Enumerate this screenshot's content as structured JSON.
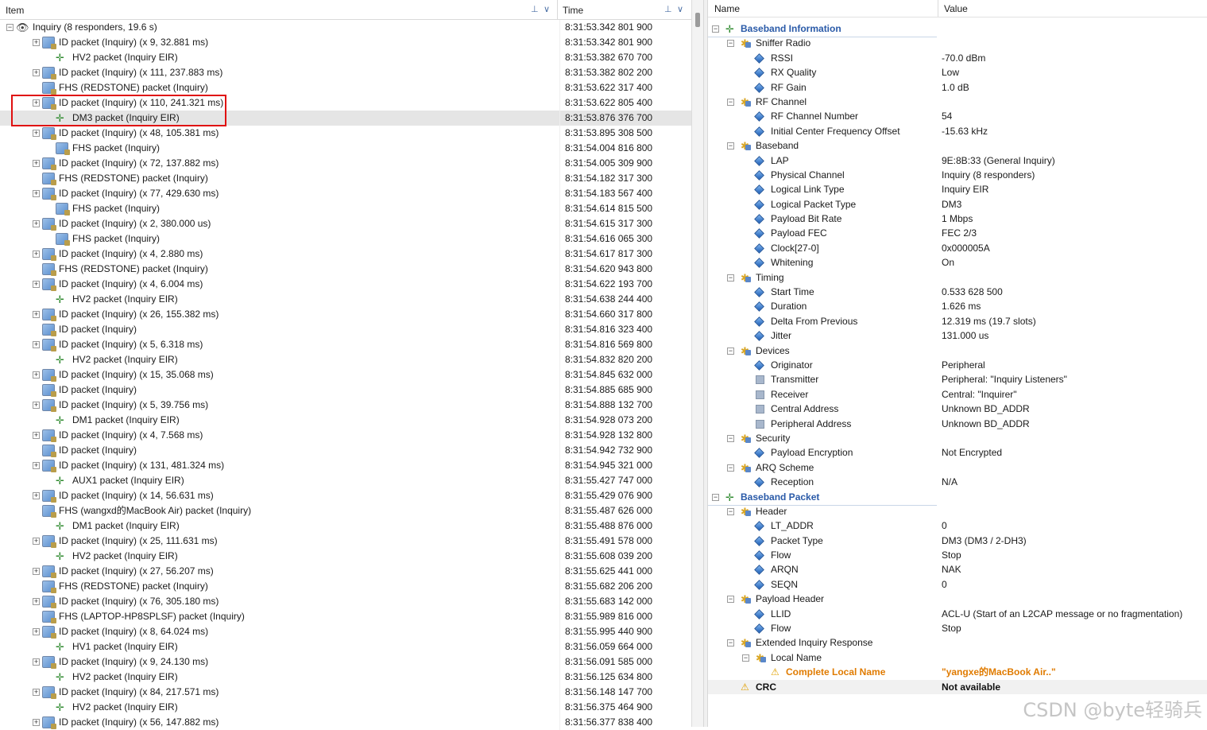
{
  "left": {
    "headers": {
      "item": "Item",
      "time": "Time"
    },
    "rows": [
      {
        "indent": 0,
        "toggle": "−",
        "icon": "eye-icon",
        "label": "Inquiry (8 responders, 19.6 s)",
        "time": "8:31:53.342 801 900"
      },
      {
        "indent": 1,
        "toggle": "+",
        "icon": "multi-packet-icon",
        "label": "ID packet (Inquiry) (x 9, 32.881 ms)",
        "time": "8:31:53.342 801 900"
      },
      {
        "indent": 2,
        "toggle": "",
        "icon": "packet-icon",
        "label": "HV2 packet (Inquiry EIR)",
        "time": "8:31:53.382 670 700"
      },
      {
        "indent": 1,
        "toggle": "+",
        "icon": "multi-packet-icon",
        "label": "ID packet (Inquiry) (x 111, 237.883 ms)",
        "time": "8:31:53.382 802 200"
      },
      {
        "indent": 1,
        "toggle": "",
        "icon": "fhs-icon",
        "label": "FHS (REDSTONE) packet (Inquiry)",
        "time": "8:31:53.622 317 400"
      },
      {
        "indent": 1,
        "toggle": "+",
        "icon": "multi-packet-icon",
        "label": "ID packet (Inquiry) (x 110, 241.321 ms)",
        "time": "8:31:53.622 805 400"
      },
      {
        "indent": 2,
        "toggle": "",
        "icon": "packet-icon",
        "label": "DM3 packet (Inquiry EIR)",
        "time": "8:31:53.876 376 700",
        "selected": true
      },
      {
        "indent": 1,
        "toggle": "+",
        "icon": "multi-packet-icon",
        "label": "ID packet (Inquiry) (x 48, 105.381 ms)",
        "time": "8:31:53.895 308 500"
      },
      {
        "indent": 2,
        "toggle": "",
        "icon": "fhs-icon",
        "label": "FHS packet (Inquiry)",
        "time": "8:31:54.004 816 800"
      },
      {
        "indent": 1,
        "toggle": "+",
        "icon": "multi-packet-icon",
        "label": "ID packet (Inquiry) (x 72, 137.882 ms)",
        "time": "8:31:54.005 309 900"
      },
      {
        "indent": 1,
        "toggle": "",
        "icon": "fhs-icon",
        "label": "FHS (REDSTONE) packet (Inquiry)",
        "time": "8:31:54.182 317 300"
      },
      {
        "indent": 1,
        "toggle": "+",
        "icon": "multi-packet-icon",
        "label": "ID packet (Inquiry) (x 77, 429.630 ms)",
        "time": "8:31:54.183 567 400"
      },
      {
        "indent": 2,
        "toggle": "",
        "icon": "fhs-icon",
        "label": "FHS packet (Inquiry)",
        "time": "8:31:54.614 815 500"
      },
      {
        "indent": 1,
        "toggle": "+",
        "icon": "multi-packet-icon",
        "label": "ID packet (Inquiry) (x 2, 380.000 us)",
        "time": "8:31:54.615 317 300"
      },
      {
        "indent": 2,
        "toggle": "",
        "icon": "fhs-icon",
        "label": "FHS packet (Inquiry)",
        "time": "8:31:54.616 065 300"
      },
      {
        "indent": 1,
        "toggle": "+",
        "icon": "multi-packet-icon",
        "label": "ID packet (Inquiry) (x 4, 2.880 ms)",
        "time": "8:31:54.617 817 300"
      },
      {
        "indent": 1,
        "toggle": "",
        "icon": "fhs-icon",
        "label": "FHS (REDSTONE) packet (Inquiry)",
        "time": "8:31:54.620 943 800"
      },
      {
        "indent": 1,
        "toggle": "+",
        "icon": "multi-packet-icon",
        "label": "ID packet (Inquiry) (x 4, 6.004 ms)",
        "time": "8:31:54.622 193 700"
      },
      {
        "indent": 2,
        "toggle": "",
        "icon": "packet-icon",
        "label": "HV2 packet (Inquiry EIR)",
        "time": "8:31:54.638 244 400"
      },
      {
        "indent": 1,
        "toggle": "+",
        "icon": "multi-packet-icon",
        "label": "ID packet (Inquiry) (x 26, 155.382 ms)",
        "time": "8:31:54.660 317 800"
      },
      {
        "indent": 1,
        "toggle": "",
        "icon": "multi-packet-icon",
        "label": "ID packet (Inquiry)",
        "time": "8:31:54.816 323 400"
      },
      {
        "indent": 1,
        "toggle": "+",
        "icon": "multi-packet-icon",
        "label": "ID packet (Inquiry) (x 5, 6.318 ms)",
        "time": "8:31:54.816 569 800"
      },
      {
        "indent": 2,
        "toggle": "",
        "icon": "packet-icon",
        "label": "HV2 packet (Inquiry EIR)",
        "time": "8:31:54.832 820 200"
      },
      {
        "indent": 1,
        "toggle": "+",
        "icon": "multi-packet-icon",
        "label": "ID packet (Inquiry) (x 15, 35.068 ms)",
        "time": "8:31:54.845 632 000"
      },
      {
        "indent": 1,
        "toggle": "",
        "icon": "multi-packet-icon",
        "label": "ID packet (Inquiry)",
        "time": "8:31:54.885 685 900"
      },
      {
        "indent": 1,
        "toggle": "+",
        "icon": "multi-packet-icon",
        "label": "ID packet (Inquiry) (x 5, 39.756 ms)",
        "time": "8:31:54.888 132 700"
      },
      {
        "indent": 2,
        "toggle": "",
        "icon": "packet-icon",
        "label": "DM1 packet (Inquiry EIR)",
        "time": "8:31:54.928 073 200"
      },
      {
        "indent": 1,
        "toggle": "+",
        "icon": "multi-packet-icon",
        "label": "ID packet (Inquiry) (x 4, 7.568 ms)",
        "time": "8:31:54.928 132 800"
      },
      {
        "indent": 1,
        "toggle": "",
        "icon": "multi-packet-icon",
        "label": "ID packet (Inquiry)",
        "time": "8:31:54.942 732 900"
      },
      {
        "indent": 1,
        "toggle": "+",
        "icon": "multi-packet-icon",
        "label": "ID packet (Inquiry) (x 131, 481.324 ms)",
        "time": "8:31:54.945 321 000"
      },
      {
        "indent": 2,
        "toggle": "",
        "icon": "packet-icon",
        "label": "AUX1 packet (Inquiry EIR)",
        "time": "8:31:55.427 747 000"
      },
      {
        "indent": 1,
        "toggle": "+",
        "icon": "multi-packet-icon",
        "label": "ID packet (Inquiry) (x 14, 56.631 ms)",
        "time": "8:31:55.429 076 900"
      },
      {
        "indent": 1,
        "toggle": "",
        "icon": "fhs-icon",
        "label": "FHS (wangxd的MacBook Air) packet (Inquiry)",
        "time": "8:31:55.487 626 000"
      },
      {
        "indent": 2,
        "toggle": "",
        "icon": "packet-icon",
        "label": "DM1 packet (Inquiry EIR)",
        "time": "8:31:55.488 876 000"
      },
      {
        "indent": 1,
        "toggle": "+",
        "icon": "multi-packet-icon",
        "label": "ID packet (Inquiry) (x 25, 111.631 ms)",
        "time": "8:31:55.491 578 000"
      },
      {
        "indent": 2,
        "toggle": "",
        "icon": "packet-icon",
        "label": "HV2 packet (Inquiry EIR)",
        "time": "8:31:55.608 039 200"
      },
      {
        "indent": 1,
        "toggle": "+",
        "icon": "multi-packet-icon",
        "label": "ID packet (Inquiry) (x 27, 56.207 ms)",
        "time": "8:31:55.625 441 000"
      },
      {
        "indent": 1,
        "toggle": "",
        "icon": "fhs-icon",
        "label": "FHS (REDSTONE) packet (Inquiry)",
        "time": "8:31:55.682 206 200"
      },
      {
        "indent": 1,
        "toggle": "+",
        "icon": "multi-packet-icon",
        "label": "ID packet (Inquiry) (x 76, 305.180 ms)",
        "time": "8:31:55.683 142 000"
      },
      {
        "indent": 1,
        "toggle": "",
        "icon": "fhs-icon",
        "label": "FHS (LAPTOP-HP8SPLSF) packet (Inquiry)",
        "time": "8:31:55.989 816 000"
      },
      {
        "indent": 1,
        "toggle": "+",
        "icon": "multi-packet-icon",
        "label": "ID packet (Inquiry) (x 8, 64.024 ms)",
        "time": "8:31:55.995 440 900"
      },
      {
        "indent": 2,
        "toggle": "",
        "icon": "packet-icon",
        "label": "HV1 packet (Inquiry EIR)",
        "time": "8:31:56.059 664 000"
      },
      {
        "indent": 1,
        "toggle": "+",
        "icon": "multi-packet-icon",
        "label": "ID packet (Inquiry) (x 9, 24.130 ms)",
        "time": "8:31:56.091 585 000"
      },
      {
        "indent": 2,
        "toggle": "",
        "icon": "packet-icon",
        "label": "HV2 packet (Inquiry EIR)",
        "time": "8:31:56.125 634 800"
      },
      {
        "indent": 1,
        "toggle": "+",
        "icon": "multi-packet-icon",
        "label": "ID packet (Inquiry) (x 84, 217.571 ms)",
        "time": "8:31:56.148 147 700"
      },
      {
        "indent": 2,
        "toggle": "",
        "icon": "packet-icon",
        "label": "HV2 packet (Inquiry EIR)",
        "time": "8:31:56.375 464 900"
      },
      {
        "indent": 1,
        "toggle": "+",
        "icon": "multi-packet-icon",
        "label": "ID packet (Inquiry) (x 56, 147.882 ms)",
        "time": "8:31:56.377 838 400"
      }
    ]
  },
  "right": {
    "headers": {
      "name": "Name",
      "value": "Value"
    },
    "rows": [
      {
        "indent": 0,
        "toggle": "−",
        "icon": "plug-icon",
        "kind": "section",
        "name": "Baseband Information",
        "value": ""
      },
      {
        "indent": 1,
        "toggle": "−",
        "icon": "gear-icon",
        "name": "Sniffer Radio",
        "value": ""
      },
      {
        "indent": 2,
        "toggle": "",
        "icon": "diamond-icon",
        "name": "RSSI",
        "value": "-70.0 dBm"
      },
      {
        "indent": 2,
        "toggle": "",
        "icon": "diamond-icon",
        "name": "RX Quality",
        "value": "Low"
      },
      {
        "indent": 2,
        "toggle": "",
        "icon": "diamond-icon",
        "name": "RF Gain",
        "value": "1.0 dB"
      },
      {
        "indent": 1,
        "toggle": "−",
        "icon": "gear-icon",
        "name": "RF Channel",
        "value": ""
      },
      {
        "indent": 2,
        "toggle": "",
        "icon": "diamond-icon",
        "name": "RF Channel Number",
        "value": "54"
      },
      {
        "indent": 2,
        "toggle": "",
        "icon": "diamond-icon",
        "name": "Initial Center Frequency Offset",
        "value": "-15.63 kHz"
      },
      {
        "indent": 1,
        "toggle": "−",
        "icon": "gear-icon",
        "name": "Baseband",
        "value": ""
      },
      {
        "indent": 2,
        "toggle": "",
        "icon": "diamond-icon",
        "name": "LAP",
        "value": "9E:8B:33 (General Inquiry)"
      },
      {
        "indent": 2,
        "toggle": "",
        "icon": "diamond-icon",
        "name": "Physical Channel",
        "value": "Inquiry (8 responders)"
      },
      {
        "indent": 2,
        "toggle": "",
        "icon": "diamond-icon",
        "name": "Logical Link Type",
        "value": "Inquiry EIR"
      },
      {
        "indent": 2,
        "toggle": "",
        "icon": "diamond-icon",
        "name": "Logical Packet Type",
        "value": "DM3"
      },
      {
        "indent": 2,
        "toggle": "",
        "icon": "diamond-icon",
        "name": "Payload Bit Rate",
        "value": "1 Mbps"
      },
      {
        "indent": 2,
        "toggle": "",
        "icon": "diamond-icon",
        "name": "Payload FEC",
        "value": "FEC 2/3"
      },
      {
        "indent": 2,
        "toggle": "",
        "icon": "diamond-icon",
        "name": "Clock[27-0]",
        "value": "0x000005A"
      },
      {
        "indent": 2,
        "toggle": "",
        "icon": "diamond-icon",
        "name": "Whitening",
        "value": "On"
      },
      {
        "indent": 1,
        "toggle": "−",
        "icon": "gear-icon",
        "name": "Timing",
        "value": ""
      },
      {
        "indent": 2,
        "toggle": "",
        "icon": "diamond-icon",
        "name": "Start Time",
        "value": "0.533 628 500"
      },
      {
        "indent": 2,
        "toggle": "",
        "icon": "diamond-icon",
        "name": "Duration",
        "value": "1.626 ms"
      },
      {
        "indent": 2,
        "toggle": "",
        "icon": "diamond-icon",
        "name": "Delta From Previous",
        "value": "12.319 ms (19.7 slots)"
      },
      {
        "indent": 2,
        "toggle": "",
        "icon": "diamond-icon",
        "name": "Jitter",
        "value": "131.000 us"
      },
      {
        "indent": 1,
        "toggle": "−",
        "icon": "gear-icon",
        "name": "Devices",
        "value": ""
      },
      {
        "indent": 2,
        "toggle": "",
        "icon": "diamond-icon",
        "name": "Originator",
        "value": "Peripheral"
      },
      {
        "indent": 2,
        "toggle": "",
        "icon": "square-icon",
        "name": "Transmitter",
        "value": "Peripheral: \"Inquiry Listeners\""
      },
      {
        "indent": 2,
        "toggle": "",
        "icon": "square-icon",
        "name": "Receiver",
        "value": "Central: \"Inquirer\""
      },
      {
        "indent": 2,
        "toggle": "",
        "icon": "square-icon",
        "name": "Central Address",
        "value": "Unknown BD_ADDR"
      },
      {
        "indent": 2,
        "toggle": "",
        "icon": "square-icon",
        "name": "Peripheral Address",
        "value": "Unknown BD_ADDR"
      },
      {
        "indent": 1,
        "toggle": "−",
        "icon": "gear-icon",
        "name": "Security",
        "value": ""
      },
      {
        "indent": 2,
        "toggle": "",
        "icon": "diamond-icon",
        "name": "Payload Encryption",
        "value": "Not Encrypted"
      },
      {
        "indent": 1,
        "toggle": "−",
        "icon": "gear-icon",
        "name": "ARQ Scheme",
        "value": ""
      },
      {
        "indent": 2,
        "toggle": "",
        "icon": "diamond-icon",
        "name": "Reception",
        "value": "N/A"
      },
      {
        "indent": 0,
        "toggle": "−",
        "icon": "plug-icon",
        "kind": "section",
        "name": "Baseband Packet",
        "value": ""
      },
      {
        "indent": 1,
        "toggle": "−",
        "icon": "gear-icon",
        "name": "Header",
        "value": ""
      },
      {
        "indent": 2,
        "toggle": "",
        "icon": "diamond-icon",
        "name": "LT_ADDR",
        "value": "0"
      },
      {
        "indent": 2,
        "toggle": "",
        "icon": "diamond-icon",
        "name": "Packet Type",
        "value": "DM3 (DM3 / 2-DH3)"
      },
      {
        "indent": 2,
        "toggle": "",
        "icon": "diamond-icon",
        "name": "Flow",
        "value": "Stop"
      },
      {
        "indent": 2,
        "toggle": "",
        "icon": "diamond-icon",
        "name": "ARQN",
        "value": "NAK"
      },
      {
        "indent": 2,
        "toggle": "",
        "icon": "diamond-icon",
        "name": "SEQN",
        "value": "0"
      },
      {
        "indent": 1,
        "toggle": "−",
        "icon": "gear-icon",
        "name": "Payload Header",
        "value": ""
      },
      {
        "indent": 2,
        "toggle": "",
        "icon": "diamond-icon",
        "name": "LLID",
        "value": "ACL-U (Start of an L2CAP message or no fragmentation)"
      },
      {
        "indent": 2,
        "toggle": "",
        "icon": "diamond-icon",
        "name": "Flow",
        "value": "Stop"
      },
      {
        "indent": 1,
        "toggle": "−",
        "icon": "gear-icon",
        "name": "Extended Inquiry Response",
        "value": ""
      },
      {
        "indent": 2,
        "toggle": "−",
        "icon": "gear-icon",
        "name": "Local Name",
        "value": ""
      },
      {
        "indent": 3,
        "toggle": "",
        "icon": "warning-icon",
        "kind": "warn",
        "name": "Complete Local Name",
        "value": "\"yangxe的MacBook Air..\""
      },
      {
        "indent": 1,
        "toggle": "",
        "icon": "warning-icon",
        "kind": "crc",
        "name": "CRC",
        "value": "Not available"
      }
    ]
  },
  "watermark": "CSDN @byte轻骑兵"
}
